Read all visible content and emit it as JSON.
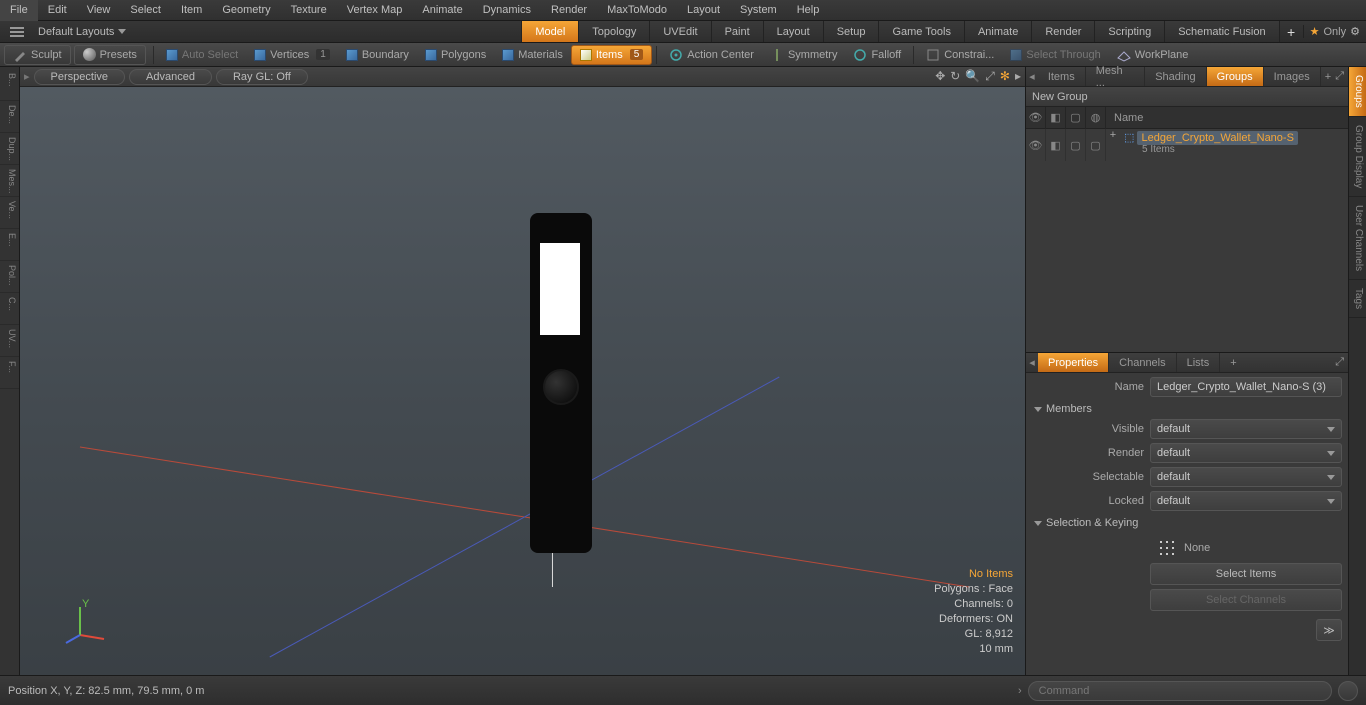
{
  "menu": [
    "File",
    "Edit",
    "View",
    "Select",
    "Item",
    "Geometry",
    "Texture",
    "Vertex Map",
    "Animate",
    "Dynamics",
    "Render",
    "MaxToModo",
    "Layout",
    "System",
    "Help"
  ],
  "layoutbar": {
    "default": "Default Layouts",
    "tabs": [
      "Model",
      "Topology",
      "UVEdit",
      "Paint",
      "Layout",
      "Setup",
      "Game Tools",
      "Animate",
      "Render",
      "Scripting",
      "Schematic Fusion"
    ],
    "active": "Model",
    "only": "Only"
  },
  "toolbar": {
    "sculpt": "Sculpt",
    "presets": "Presets",
    "autoselect": "Auto Select",
    "vertices": "Vertices",
    "vertices_badge": "1",
    "boundary": "Boundary",
    "polygons": "Polygons",
    "materials": "Materials",
    "items": "Items",
    "items_badge": "5",
    "actioncenter": "Action Center",
    "symmetry": "Symmetry",
    "falloff": "Falloff",
    "constraints": "Constrai...",
    "selectthrough": "Select Through",
    "workplane": "WorkPlane"
  },
  "vtabs": [
    "B...",
    "De...",
    "Dup...",
    "Mes...",
    "Ve...",
    "E...",
    "Pol...",
    "C...",
    "UV...",
    "F..."
  ],
  "viewport": {
    "pills": [
      "Perspective",
      "Advanced",
      "Ray GL: Off"
    ],
    "overlay": {
      "warn": "No Items",
      "polygons": "Polygons : Face",
      "channels": "Channels: 0",
      "deformers": "Deformers: ON",
      "gl": "GL: 8,912",
      "grid": "10 mm"
    }
  },
  "right": {
    "top_tabs": [
      "Items",
      "Mesh ...",
      "Shading",
      "Groups",
      "Images"
    ],
    "top_active": "Groups",
    "newgroup": "New Group",
    "name_header": "Name",
    "item": {
      "name": "Ledger_Crypto_Wallet_Nano-S",
      "sub": "5 Items"
    },
    "prop_tabs": [
      "Properties",
      "Channels",
      "Lists"
    ],
    "prop_active": "Properties",
    "name_label": "Name",
    "name_value": "Ledger_Crypto_Wallet_Nano-S (3)",
    "members": "Members",
    "visible": "Visible",
    "render": "Render",
    "selectable": "Selectable",
    "locked": "Locked",
    "default": "default",
    "selkey": "Selection & Keying",
    "none": "None",
    "selitems": "Select Items",
    "selchannels": "Select Channels",
    "side": [
      "Groups",
      "Group Display",
      "User Channels",
      "Tags"
    ],
    "side_active": "Groups"
  },
  "status": {
    "pos": "Position X, Y, Z:   82.5 mm, 79.5 mm, 0 m",
    "cmd": "Command"
  }
}
